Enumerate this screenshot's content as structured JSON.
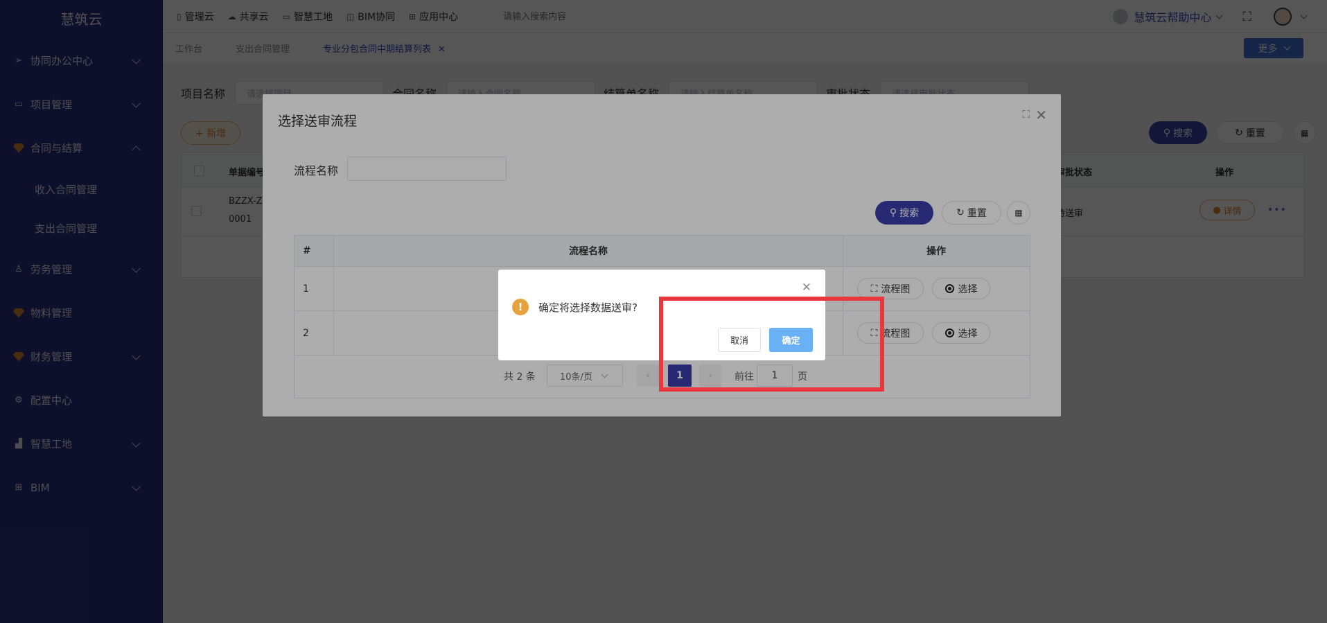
{
  "app": {
    "logo": "慧筑云"
  },
  "sidebar": {
    "items": [
      {
        "label": "协同办公中心",
        "icon": "send-icon",
        "expandable": true
      },
      {
        "label": "项目管理",
        "icon": "book-icon",
        "expandable": true
      },
      {
        "label": "合同与结算",
        "icon": "gem-icon",
        "expandable": true,
        "expanded": true
      },
      {
        "label": "劳务管理",
        "icon": "user-icon",
        "expandable": true
      },
      {
        "label": "物料管理",
        "icon": "gem-icon",
        "expandable": false
      },
      {
        "label": "财务管理",
        "icon": "gem-icon",
        "expandable": true
      },
      {
        "label": "配置中心",
        "icon": "gear-icon",
        "expandable": false
      },
      {
        "label": "智慧工地",
        "icon": "bar-chart-icon",
        "expandable": true
      },
      {
        "label": "BIM",
        "icon": "grid-icon",
        "expandable": true
      }
    ],
    "sub_items": [
      {
        "label": "收入合同管理",
        "icon": "gem-icon"
      },
      {
        "label": "支出合同管理",
        "icon": "gem-icon"
      }
    ]
  },
  "topbar": {
    "nav": [
      {
        "label": "管理云",
        "icon": "doc-icon"
      },
      {
        "label": "共享云",
        "icon": "cloud-icon"
      },
      {
        "label": "智慧工地",
        "icon": "book-icon"
      },
      {
        "label": "BIM协同",
        "icon": "cube-icon"
      },
      {
        "label": "应用中心",
        "icon": "apps-icon"
      }
    ],
    "search_placeholder": "请输入搜索内容",
    "help_label": "慧筑云帮助中心"
  },
  "tabs": {
    "items": [
      {
        "label": "工作台",
        "active": false
      },
      {
        "label": "支出合同管理",
        "active": false
      },
      {
        "label": "专业分包合同中期结算列表",
        "active": true
      }
    ],
    "more_label": "更多"
  },
  "filters": {
    "project_label": "项目名称",
    "project_placeholder": "请选择项目",
    "contract_label": "合同名称",
    "contract_placeholder": "请输入合同名称",
    "settle_label": "结算单名称",
    "settle_placeholder": "请输入结算单名称",
    "status_label": "审批状态",
    "status_placeholder": "请选择审批状态"
  },
  "page_actions": {
    "add": "+ 新增",
    "search": "搜索",
    "reset": "重置"
  },
  "bg_table": {
    "col_code": "单据编号",
    "col_status": "审批状态",
    "col_ops": "操作",
    "row": {
      "code_line1": "BZZX-Z",
      "code_line2": "0001",
      "status": "待送审",
      "detail": "详情"
    }
  },
  "dialog": {
    "title": "选择送审流程",
    "filter_label": "流程名称",
    "search": "搜索",
    "reset": "重置",
    "table": {
      "headers": [
        "#",
        "流程名称",
        "操作"
      ],
      "rows": [
        {
          "index": "1",
          "name": ""
        },
        {
          "index": "2",
          "name": ""
        }
      ],
      "flow_btn": "流程图",
      "pick_btn": "选择"
    },
    "pager": {
      "total": "共 2 条",
      "page_size": "10条/页",
      "current": "1",
      "goto_label": "前往",
      "goto_value": "1",
      "page_suffix": "页"
    }
  },
  "confirm": {
    "message": "确定将选择数据送审?",
    "cancel": "取消",
    "ok": "确定"
  },
  "colors": {
    "sidebar": "#2b2f80",
    "primary": "#3a3fa8",
    "warning": "#e6a23c",
    "highlight": "#e8383d",
    "ok_button": "#6ab0f5"
  }
}
